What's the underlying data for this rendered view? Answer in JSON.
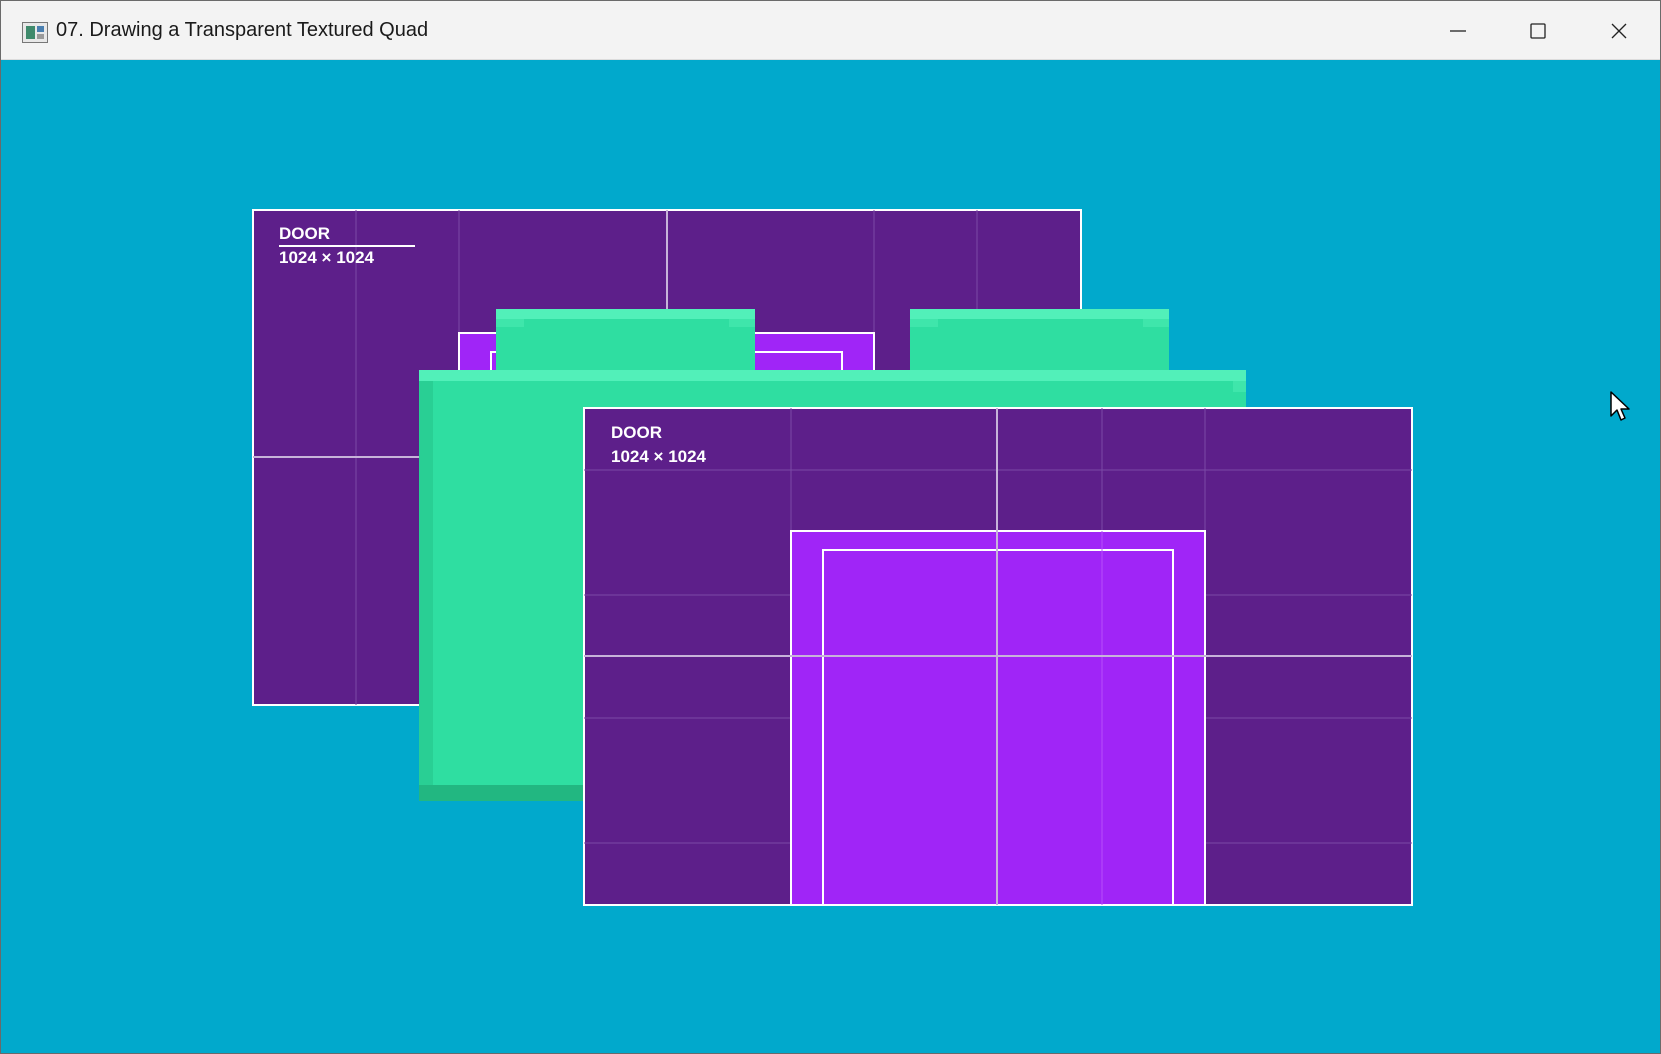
{
  "window": {
    "title": "07. Drawing a Transparent Textured Quad",
    "icon": "app-window-icon",
    "controls": [
      "minimize-icon",
      "maximize-icon",
      "close-icon"
    ]
  },
  "scene": {
    "background_color": "#01a9cc",
    "texture_label": "DOOR",
    "texture_size": "1024 × 1024",
    "colors": {
      "wall_purple": "#5d1f8a",
      "door_violet": "#a025f7",
      "grass_green": "#2fdea1",
      "line_white": "#ffffff"
    }
  }
}
